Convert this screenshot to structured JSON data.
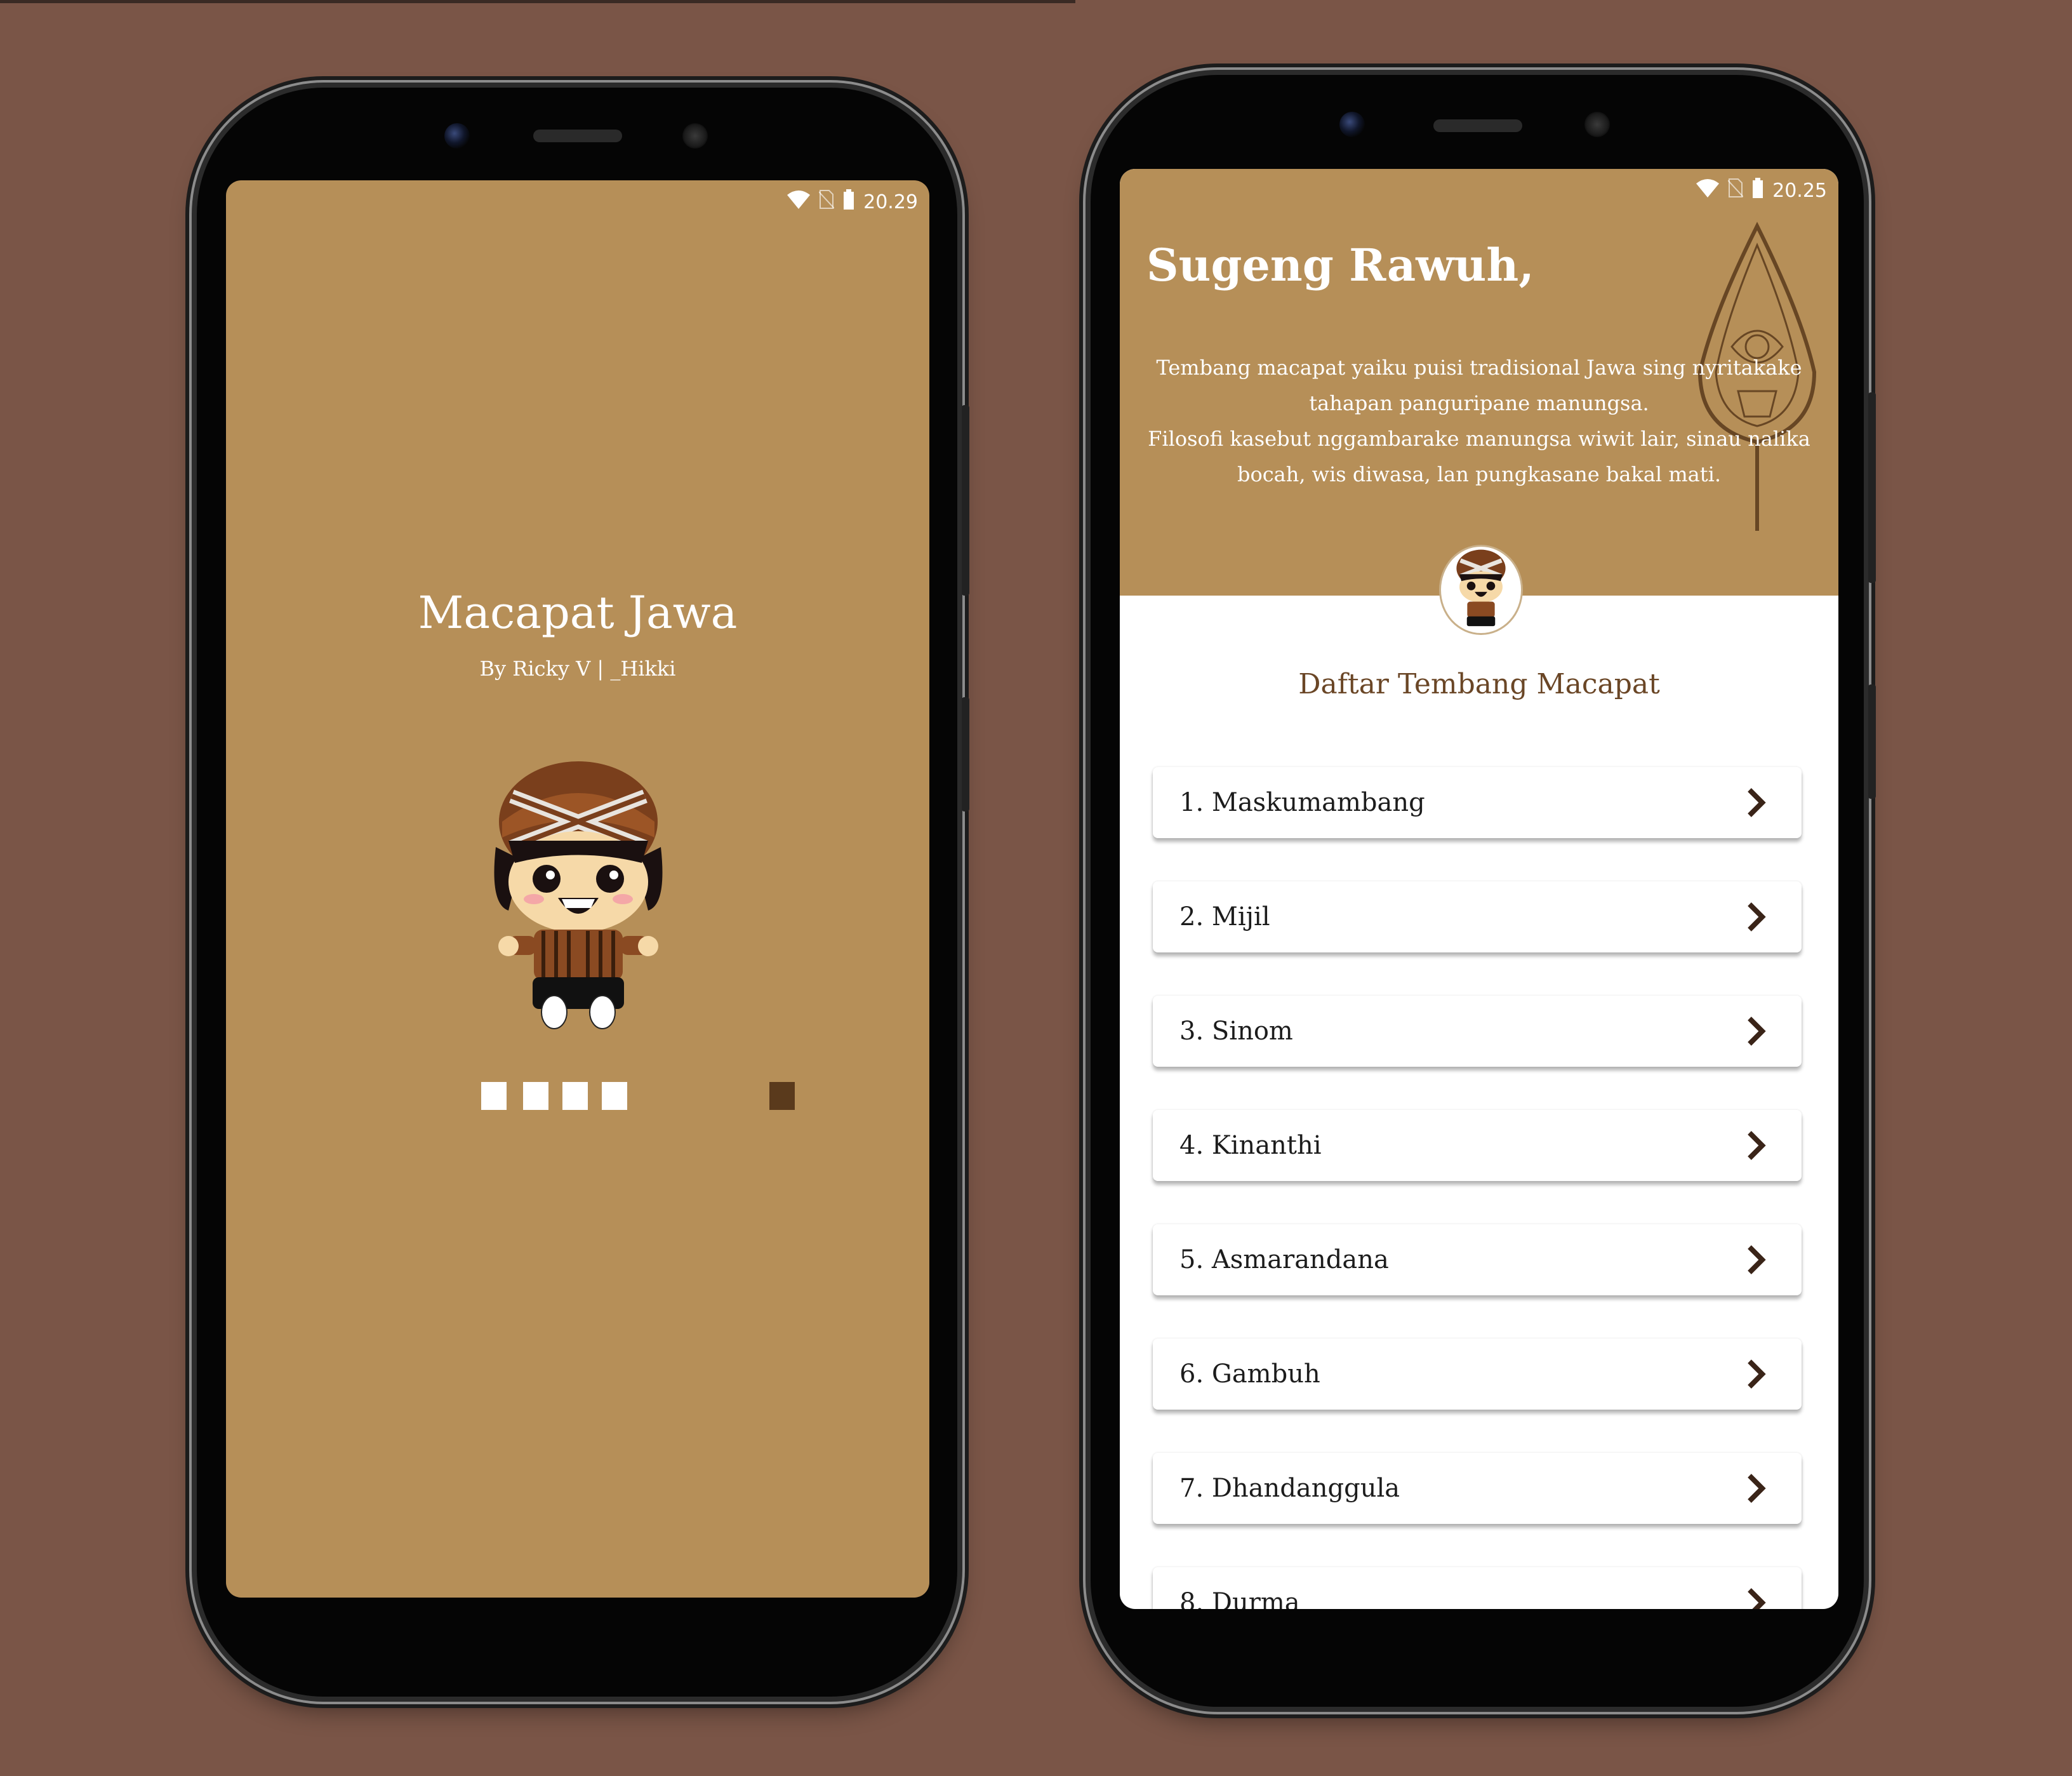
{
  "splash": {
    "status_time": "20.29",
    "title": "Macapat Jawa",
    "subtitle": "By Ricky V | _Hikki"
  },
  "home": {
    "status_time": "20.25",
    "greeting": "Sugeng Rawuh,",
    "intro_line1": "Tembang macapat yaiku puisi tradisional Jawa sing nyritakake tahapan panguripane manungsa.",
    "intro_line2": "Filosofi kasebut nggambarake manungsa wiwit lair, sinau nalika bocah, wis diwasa, lan pungkasane bakal mati.",
    "list_title": "Daftar Tembang Macapat",
    "items": [
      {
        "label": "1. Maskumambang"
      },
      {
        "label": "2. Mijil"
      },
      {
        "label": "3. Sinom"
      },
      {
        "label": "4. Kinanthi"
      },
      {
        "label": "5. Asmarandana"
      },
      {
        "label": "6. Gambuh"
      },
      {
        "label": "7. Dhandanggula"
      },
      {
        "label": "8. Durma"
      }
    ]
  },
  "colors": {
    "background": "#7a5547",
    "brand": "#b68f58",
    "accent_dark": "#5a3a1c",
    "list_title": "#6a4626"
  },
  "icons": [
    "wifi-icon",
    "no-sim-icon",
    "battery-icon",
    "chevron-right-icon",
    "wayang-kayon-icon",
    "mascot-icon"
  ]
}
